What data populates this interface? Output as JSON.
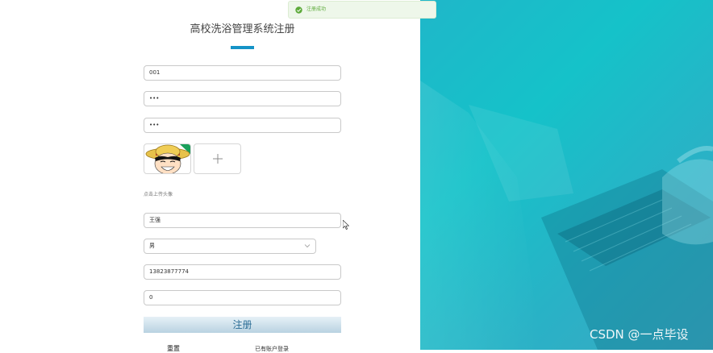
{
  "form": {
    "title": "高校洗浴管理系统注册",
    "account_value": "001",
    "password_value": "•••",
    "confirm_password_value": "•••",
    "upload_hint": "点击上传头像",
    "name_value": "王强",
    "gender_value": "男",
    "phone_value": "13823877774",
    "balance_value": "0",
    "register_label": "注册",
    "reset_label": "重置",
    "login_link": "已有账户登录"
  },
  "toast": {
    "message": "注册成功"
  },
  "watermark": "CSDN @一点毕设",
  "colors": {
    "accent": "#1593c7",
    "toast_green": "#5daa3a",
    "panel_teal": "#15c2c9"
  },
  "icons": {
    "upload": "plus-icon",
    "select": "chevron-down-icon",
    "toast": "check-circle-icon"
  }
}
